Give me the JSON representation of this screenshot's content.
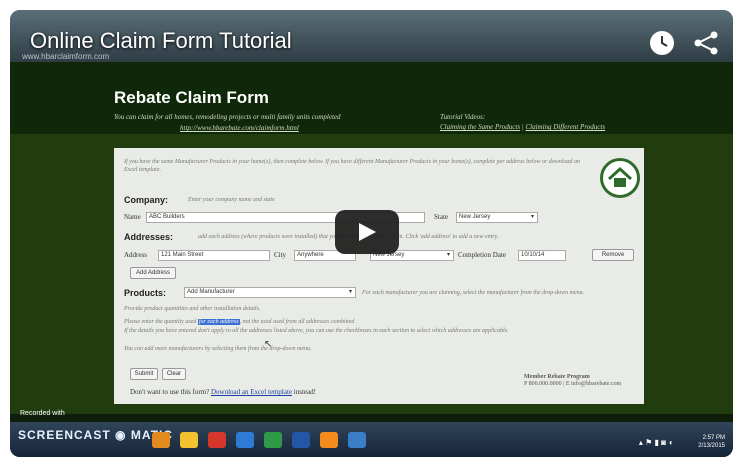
{
  "video": {
    "title": "Online Claim Form Tutorial",
    "url": "www.hbarclaimform.com",
    "recorded_with": "Recorded with",
    "screencast_logo": "SCREENCAST",
    "screencast_logo2": "MATIC",
    "clock_time": "2:57 PM",
    "clock_date": "2/13/2015"
  },
  "page": {
    "title": "Rebate Claim Form",
    "subtitle": "You can claim for all homes, remodeling projects or multi family units completed",
    "subtitle_url": "http://www.hbarebate.com/claimform.html",
    "tutorial_label": "Tutorial Videos:",
    "tutorial_link1": "Claiming the Same Products",
    "tutorial_sep": "|",
    "tutorial_link2": "Claiming Different Products"
  },
  "form": {
    "intro": "If you have the same Manufacturer Products in your home(s), then complete below. If you have different Manufacturer Products in your home(s), complete per address below or download an Excel template.",
    "company_label": "Company:",
    "company_hint": "Enter your company name and state",
    "name_label": "Name",
    "name_value": "ABC Builders",
    "state_label": "State",
    "state_value": "New Jersey",
    "addresses_label": "Addresses:",
    "addresses_hint": "add each address (where products were installed) that you are making a rebate claim. Click 'add address' to add a new entry.",
    "address_label": "Address",
    "address_value": "121 Main Street",
    "city_label": "City",
    "city_value": "Anywhere",
    "address_state_value": "New Jersey",
    "completion_label": "Completion Date",
    "completion_value": "10/10/14",
    "remove_label": "Remove",
    "add_address_label": "Add Address",
    "products_label": "Products:",
    "products_select": "Add Manufacturer",
    "products_hint": "For each manufacturer you are claiming, select the manufacturer from the drop-down menu.",
    "products_note1": "Provide product quantities and other installation details.",
    "products_note2a": "Please enter the quantity used",
    "products_note2b": "for each address",
    "products_note2c": ", not the total used from all addresses combined",
    "products_note3": "If the details you have entered don't apply to all the addresses listed above, you can use the checkboxes in each section to select which addresses are applicable.",
    "products_note4": "You can add more manufacturers by selecting them from the drop-down menu.",
    "submit_label": "Submit",
    "clear_label": "Clear",
    "excel_text_pre": "Don't want to use this form?",
    "excel_link": "Download an Excel template",
    "excel_text_post": "instead!",
    "program_name": "Member Rebate Program",
    "program_contact": "P 800.000.0000 | E info@hbarebate.com"
  }
}
